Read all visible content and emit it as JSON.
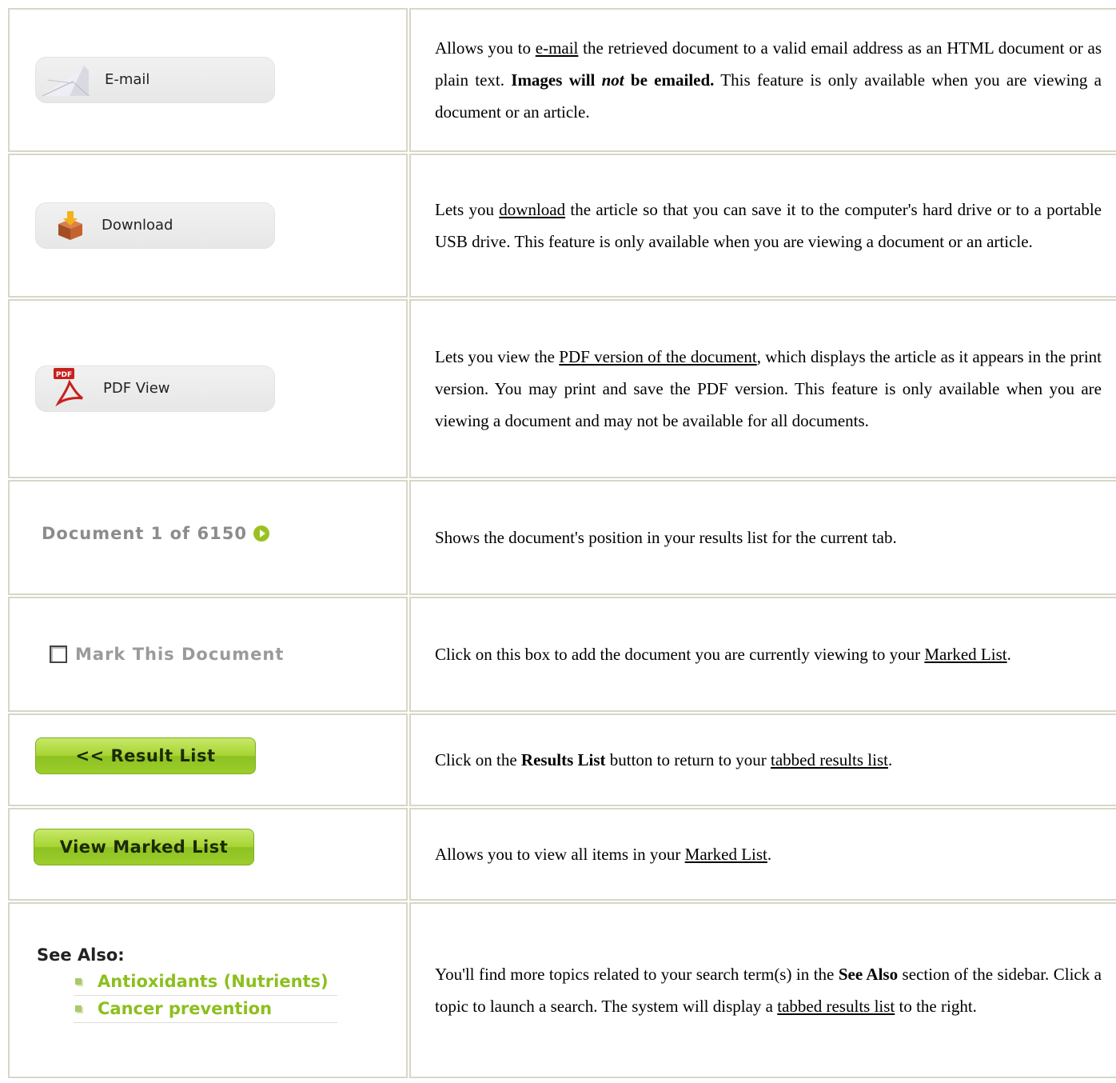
{
  "rows": [
    {
      "button": {
        "label": "E-mail",
        "icon": "envelope-icon"
      },
      "desc": {
        "t1": "Allows you to ",
        "link": "e-mail",
        "t2": " the retrieved document to a valid email address as an HTML document or as plain text.  ",
        "b1": "Images will ",
        "bi": "not",
        "b2": " be emailed.",
        "t3": " This feature is only available when you are viewing a document or an article."
      }
    },
    {
      "button": {
        "label": "Download",
        "icon": "download-box-icon"
      },
      "desc": {
        "t1": "Lets you ",
        "link": "download",
        "t2": " the article so that you can save it to the computer's hard drive or to a portable USB drive. This feature is only available when you are viewing a document or an article."
      }
    },
    {
      "button": {
        "label": "PDF View",
        "icon": "pdf-icon",
        "icon_text": "PDF"
      },
      "desc": {
        "t1": "Lets you view the ",
        "link": "PDF version of the document",
        "t2": ", which displays the article as it appears in the print version. You may print and save the PDF version. This feature is only available when you are viewing a document and may not be available for all documents."
      }
    },
    {
      "widget": {
        "label": "Document 1 of 6150",
        "icon": "next-arrow-icon"
      },
      "desc": {
        "t1": "Shows the document's position in your results list for the current tab."
      }
    },
    {
      "widget": {
        "label": "Mark This Document"
      },
      "desc": {
        "t1": "Click on this box to add the document you are currently viewing to your ",
        "link": "Marked List",
        "t2": "."
      }
    },
    {
      "button": {
        "label": "<< Result List"
      },
      "desc": {
        "t1": "Click on the ",
        "b1": "Results List",
        "t2": " button to return to your ",
        "link": "tabbed results list",
        "t3": "."
      }
    },
    {
      "button": {
        "label": "View Marked List"
      },
      "desc": {
        "t1": "Allows you to view all items in your ",
        "link": "Marked List",
        "t2": "."
      }
    },
    {
      "widget": {
        "heading": "See Also:",
        "items": [
          "Antioxidants (Nutrients)",
          "Cancer prevention"
        ]
      },
      "desc": {
        "t1": "You'll find more topics related to your search term(s) in the ",
        "b1": "See Also",
        "t2": " section of the sidebar. Click a topic to launch a search. The system will display a ",
        "link": "tabbed results list",
        "t3": " to the right."
      }
    }
  ],
  "colors": {
    "border": "#d8d6c7",
    "green": "#9ccd2b",
    "link_green": "#8cbf1e"
  }
}
